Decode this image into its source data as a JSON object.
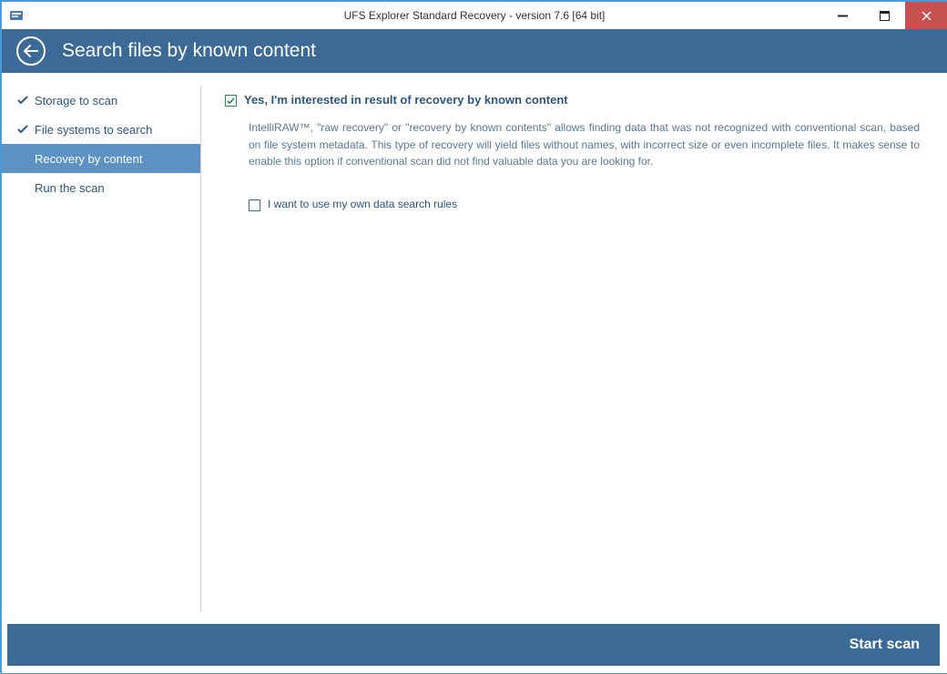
{
  "window": {
    "title": "UFS Explorer Standard Recovery - version 7.6 [64 bit]"
  },
  "header": {
    "title": "Search files by known content"
  },
  "sidebar": {
    "items": [
      {
        "label": "Storage to scan",
        "completed": true,
        "active": false
      },
      {
        "label": "File systems to search",
        "completed": true,
        "active": false
      },
      {
        "label": "Recovery by content",
        "completed": false,
        "active": true
      },
      {
        "label": "Run the scan",
        "completed": false,
        "active": false
      }
    ]
  },
  "content": {
    "checkbox_main_label": "Yes, I'm interested in result of recovery by known content",
    "checkbox_main_checked": true,
    "description": "IntelliRAW™, \"raw recovery\" or \"recovery by known contents\" allows finding data that was not recognized with conventional scan, based on file system metadata. This type of recovery will yield files without names, with incorrect size or even incomplete files. It makes sense to enable this option if conventional scan did not find valuable data you are looking for.",
    "checkbox_rules_label": "I want to use my own data search rules",
    "checkbox_rules_checked": false
  },
  "footer": {
    "start_label": "Start scan"
  }
}
